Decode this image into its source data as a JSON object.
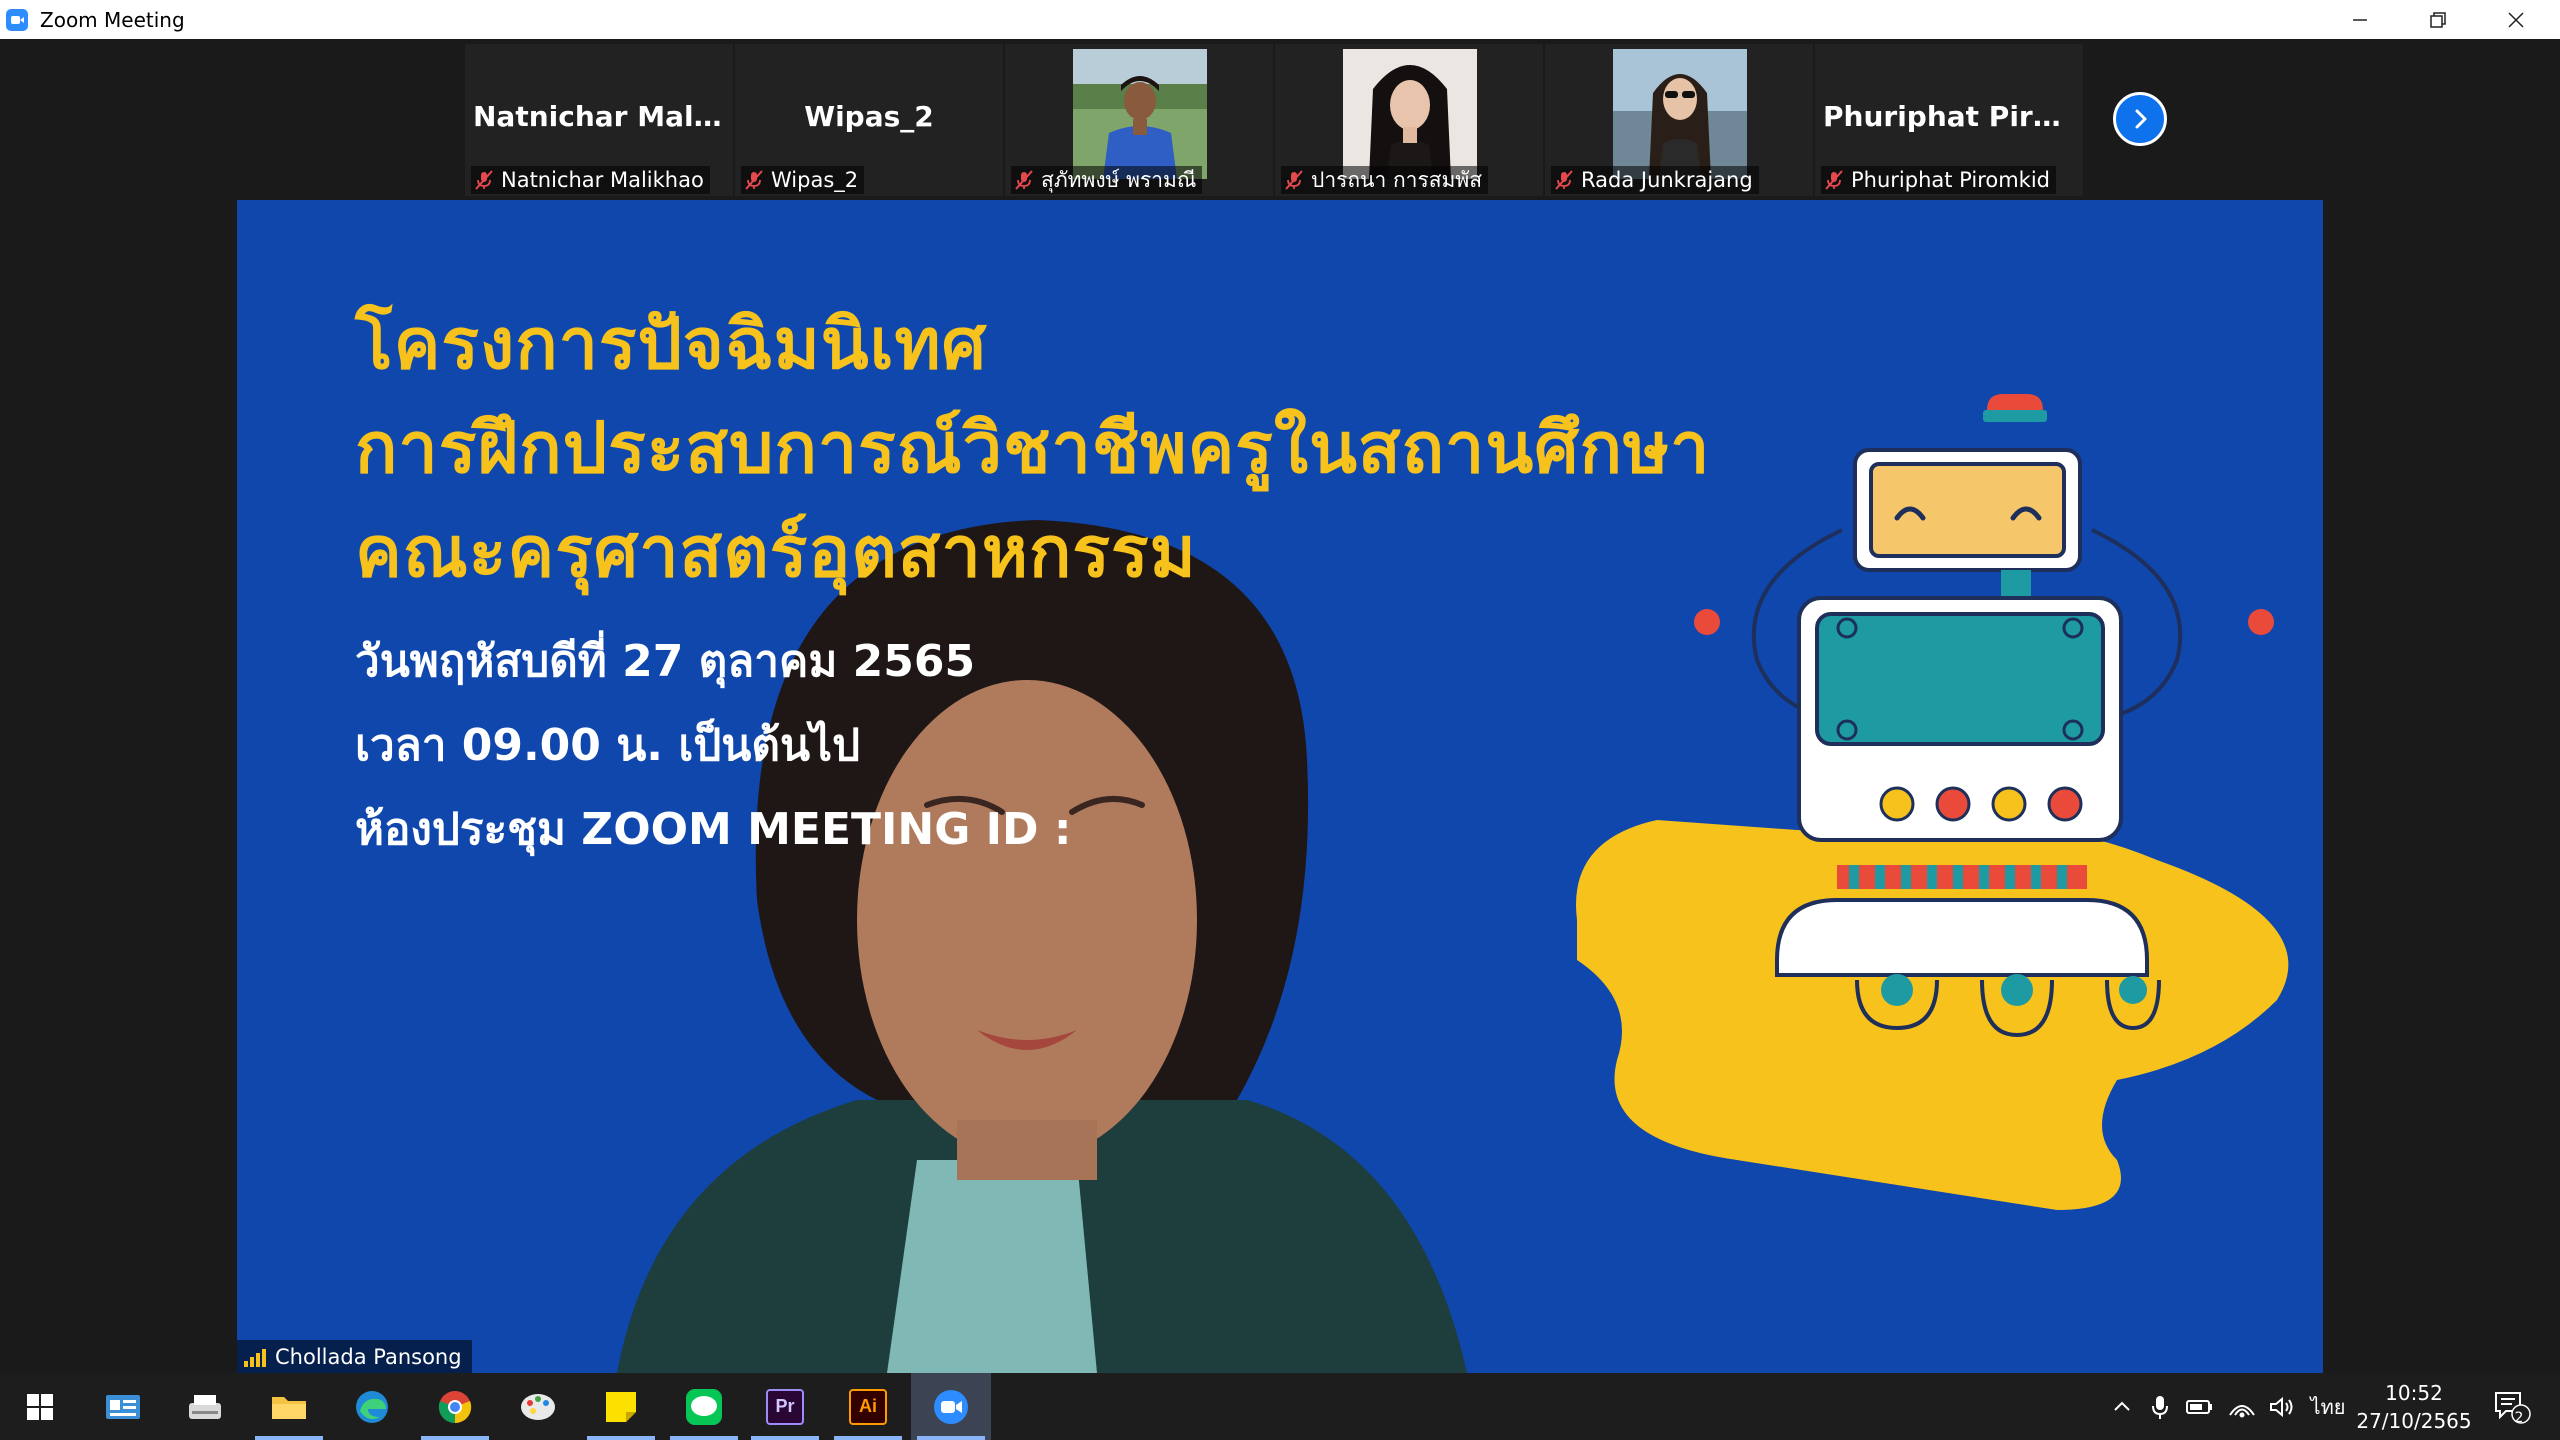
{
  "window": {
    "title": "Zoom Meeting",
    "minimize_label": "—",
    "restore_label": "❐",
    "close_label": "✕"
  },
  "gallery": {
    "tiles": [
      {
        "big_name": "Natnichar  Malik...",
        "name": "Natnichar Malikhao",
        "has_photo": false,
        "muted": true
      },
      {
        "big_name": "Wipas_2",
        "name": "Wipas_2",
        "has_photo": false,
        "muted": true
      },
      {
        "big_name": "",
        "name": "สุภัทพงษ์ พรามณี",
        "has_photo": true,
        "muted": true
      },
      {
        "big_name": "",
        "name": "ปารถนา การสมพัส",
        "has_photo": true,
        "muted": true
      },
      {
        "big_name": "",
        "name": "Rada Junkrajang",
        "has_photo": true,
        "muted": true
      },
      {
        "big_name": "Phuriphat  Piro...",
        "name": "Phuriphat Piromkid",
        "has_photo": false,
        "muted": true
      }
    ],
    "next_icon": "chevron-right-icon"
  },
  "slide": {
    "title_lines": [
      "โครงการปัจฉิมนิเทศ",
      "การฝึกประสบการณ์วิชาชีพครูในสถานศึกษา",
      "คณะครุศาสตร์อุตสาหกรรม"
    ],
    "detail_lines": [
      "วันพฤหัสบดีที่ 27 ตุลาคม 2565",
      "เวลา 09.00 น. เป็นต้นไป",
      "ห้องประชุม ZOOM MEETING ID :"
    ],
    "colors": {
      "background": "#0f47ad",
      "title": "#f6c21b",
      "accent_yellow": "#f6c21b"
    }
  },
  "speaker": {
    "name": "Chollada Pansong"
  },
  "taskbar": {
    "apps": [
      "windows-start",
      "news",
      "scanner",
      "file-explorer",
      "edge",
      "chrome",
      "paint",
      "sticky-notes",
      "line",
      "premiere-pro",
      "illustrator",
      "zoom"
    ],
    "premiere_label": "Pr",
    "illustrator_label": "Ai",
    "line_label": "LINE",
    "lang": "ไทย",
    "time": "10:52",
    "date": "27/10/2565",
    "notifications": "2"
  }
}
